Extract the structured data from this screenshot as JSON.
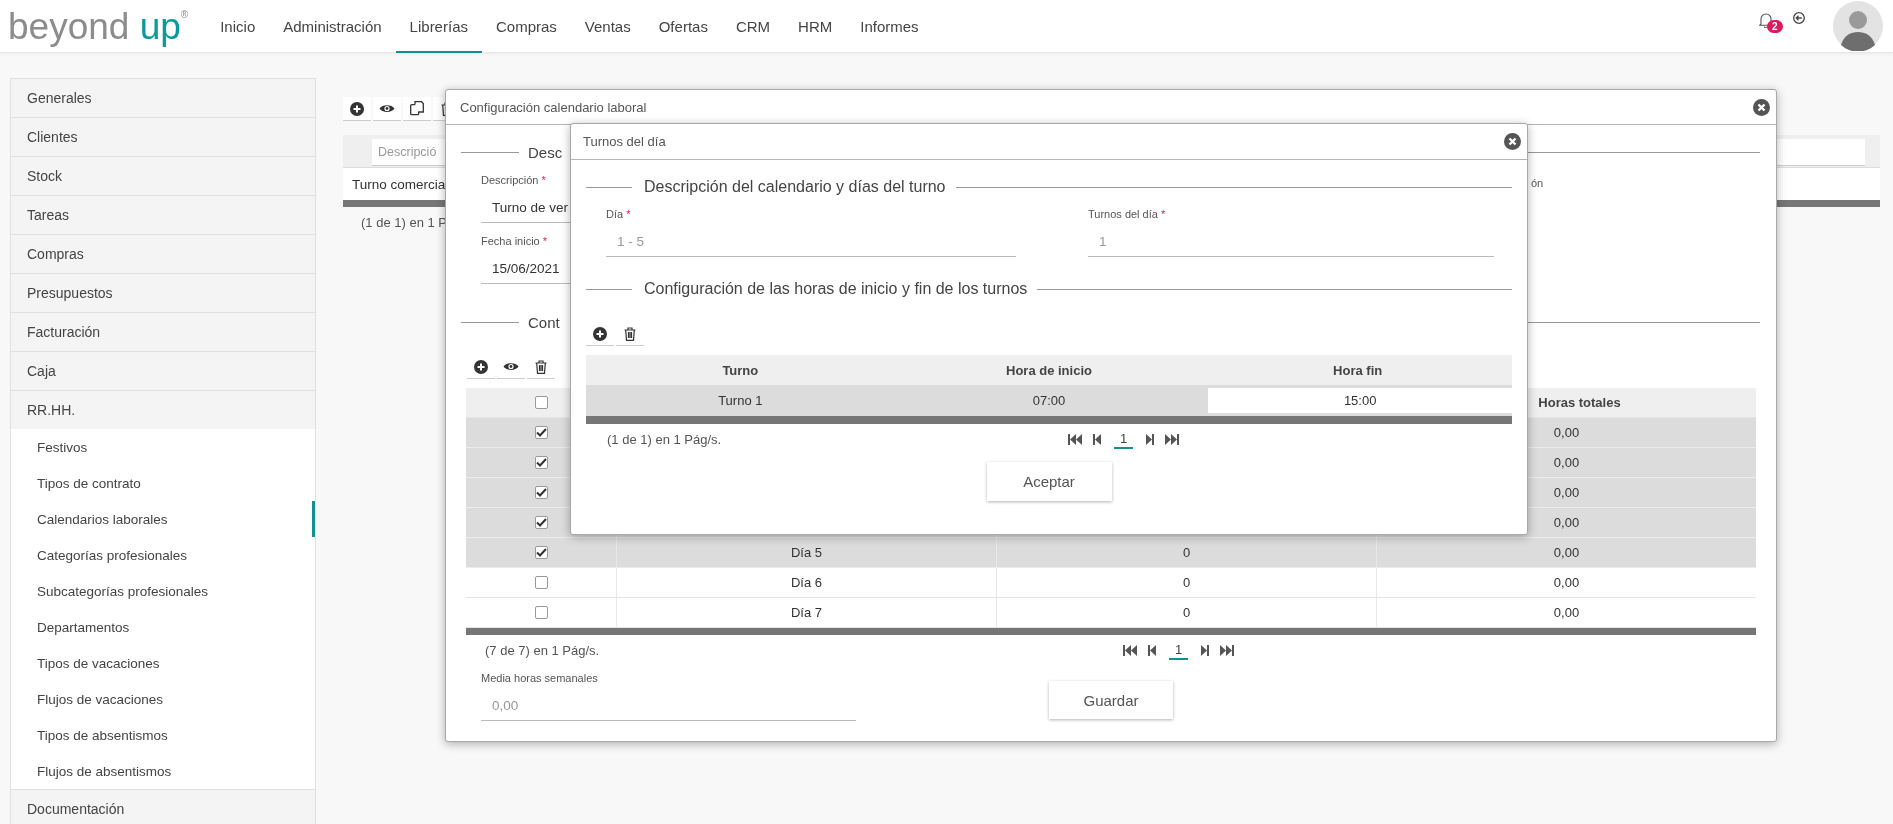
{
  "header": {
    "logo": {
      "text": "beyond",
      "accent": "up",
      "mark": "®"
    },
    "nav": [
      {
        "label": "Inicio",
        "selected": false
      },
      {
        "label": "Administración",
        "selected": false
      },
      {
        "label": "Librerías",
        "selected": true
      },
      {
        "label": "Compras",
        "selected": false
      },
      {
        "label": "Ventas",
        "selected": false
      },
      {
        "label": "Ofertas",
        "selected": false
      },
      {
        "label": "CRM",
        "selected": false
      },
      {
        "label": "HRM",
        "selected": false
      },
      {
        "label": "Informes",
        "selected": false
      }
    ],
    "notifications": {
      "count": "2"
    }
  },
  "sidebar": {
    "items": [
      {
        "label": "Generales"
      },
      {
        "label": "Clientes"
      },
      {
        "label": "Stock"
      },
      {
        "label": "Tareas"
      },
      {
        "label": "Compras"
      },
      {
        "label": "Presupuestos"
      },
      {
        "label": "Facturación"
      },
      {
        "label": "Caja"
      },
      {
        "label": "RR.HH.",
        "children": [
          {
            "label": "Festivos",
            "selected": false
          },
          {
            "label": "Tipos de contrato",
            "selected": false
          },
          {
            "label": "Calendarios laborales",
            "selected": true
          },
          {
            "label": "Categorías profesionales",
            "selected": false
          },
          {
            "label": "Subcategorías profesionales",
            "selected": false
          },
          {
            "label": "Departamentos",
            "selected": false
          },
          {
            "label": "Tipos de vacaciones",
            "selected": false
          },
          {
            "label": "Flujos de vacaciones",
            "selected": false
          },
          {
            "label": "Tipos de absentismos",
            "selected": false
          },
          {
            "label": "Flujos de absentismos",
            "selected": false
          }
        ]
      },
      {
        "label": "Documentación"
      }
    ]
  },
  "page": {
    "search": {
      "placeholder": "Descripció"
    },
    "rows": [
      "Turno comercia"
    ],
    "footer": "(1 de 1) en 1 P"
  },
  "calendar_dialog": {
    "title": "Configuración calendario laboral",
    "sections": [
      "Desc",
      "Cont"
    ],
    "fields": [
      {
        "label": "Descripción",
        "required_mark": "*",
        "value": "Turno de ver",
        "disabled": false
      },
      {
        "label": "Fecha inicio",
        "required_mark": "*",
        "value": "15/06/2021",
        "disabled": false
      }
    ],
    "side_label": "ón",
    "table": {
      "header_checked": false,
      "hours_header": "Horas totales",
      "rows": [
        {
          "checked": true,
          "selected": true,
          "hours": "0,00"
        },
        {
          "checked": true,
          "selected": true,
          "hours": "0,00"
        },
        {
          "checked": true,
          "selected": true,
          "hours": "0,00"
        },
        {
          "checked": true,
          "selected": true,
          "hours": "0,00"
        },
        {
          "checked": true,
          "selected": true,
          "day": "Día 5",
          "value": "0",
          "hours": "0,00"
        },
        {
          "checked": false,
          "selected": false,
          "day": "Día 6",
          "value": "0",
          "hours": "0,00"
        },
        {
          "checked": false,
          "selected": false,
          "day": "Día 7",
          "value": "0",
          "hours": "0,00"
        }
      ]
    },
    "footer": "(7 de 7) en 1 Pág/s.",
    "pager": {
      "page": "1"
    },
    "average": {
      "label": "Media horas semanales",
      "value": "0,00",
      "disabled": true
    },
    "button": "Guardar"
  },
  "shifts_dialog": {
    "title": "Turnos del día",
    "sections": [
      "Descripción del calendario y días del turno",
      "Configuración de las horas de inicio y fin de los turnos"
    ],
    "fields": [
      {
        "label": "Día",
        "required_mark": "*",
        "value": "1 - 5",
        "disabled": true
      },
      {
        "label": "Turnos del día",
        "required_mark": "*",
        "value": "1",
        "disabled": true
      }
    ],
    "table": {
      "columns": [
        "Turno",
        "Hora de inicio",
        "Hora fin"
      ],
      "rows": [
        {
          "selected": true,
          "cells": [
            {
              "text": "Turno 1",
              "editing": false
            },
            {
              "text": "07:00",
              "editing": false
            },
            {
              "text": "15:00",
              "editing": true
            }
          ]
        }
      ]
    },
    "footer": "(1 de 1) en 1 Pág/s.",
    "pager": {
      "page": "1"
    },
    "button": "Aceptar"
  }
}
